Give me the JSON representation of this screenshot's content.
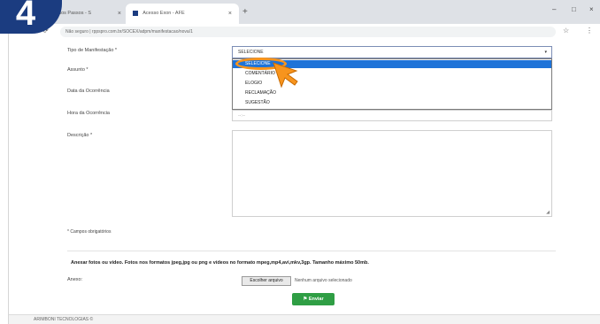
{
  "step_number": "4",
  "browser": {
    "tab_first_title": "...ação dos Passos - S",
    "tab_active_title": "Acesso Exon - AFE",
    "tab_close": "×",
    "new_tab": "+",
    "window_controls": [
      "–",
      "□",
      "×"
    ],
    "nav": {
      "back": "←",
      "forward": "→",
      "reload": "⟳"
    },
    "url": "Não seguro | rppspro.com.br/SOCEX/adpm/manifestacao/nova/1",
    "star": "☆",
    "menu": "⋮"
  },
  "form": {
    "tipo_label": "Tipo de Manifestação *",
    "select_value": "SELECIONE",
    "select_arrow": "▾",
    "options": [
      "SELECIONE",
      "COMENTÁRIO",
      "ELOGIO",
      "RECLAMAÇÃO",
      "SUGESTÃO"
    ],
    "selected_index": 0,
    "assunto_label": "Assunto *",
    "data_label": "Data da Ocorrência",
    "hora_label": "Hora da Ocorrência",
    "hora_placeholder": "--:--",
    "descricao_label": "Descrição *",
    "resize_glyph": "◢",
    "required_note": "* Campos obrigatórios",
    "attach_note": "Anexar fotos ou vídeo. Fotos nos formatos jpeg,jpg ou png e vídeos no formato mpeg,mp4,avi,mkv,3gp. Tamanho máximo 50mb.",
    "anexo_label": "Anexo:",
    "file_button": "Escolher arquivo",
    "file_status": "Nenhum arquivo selecionado",
    "submit_icon": "⚑",
    "submit_label": "Enviar"
  },
  "footer": {
    "text": "ARIMBONI TECNOLOGIAS ©"
  },
  "colors": {
    "highlight": "#f7941d",
    "option_selected_bg": "#1e73d8",
    "submit_bg": "#2f9e44",
    "badge_bg": "#1b3c80"
  }
}
